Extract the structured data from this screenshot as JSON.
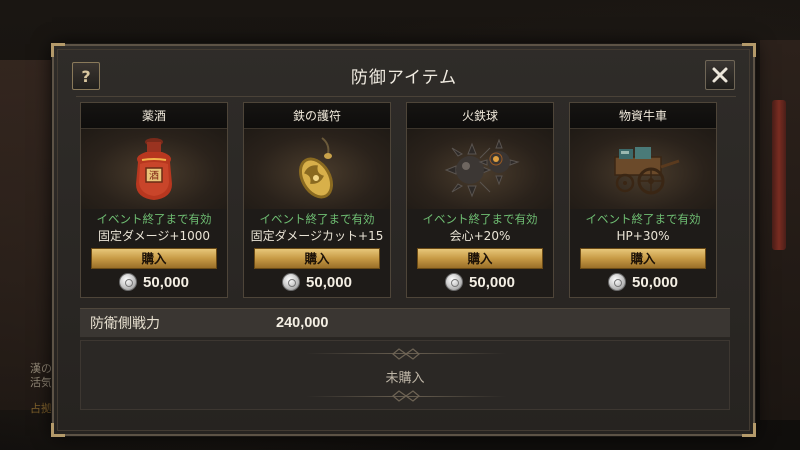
{
  "background": {
    "text_line1": "漢の",
    "text_line2": "活気",
    "text_line3": "占拠"
  },
  "dialog": {
    "title": "防御アイテム",
    "help_label": "?",
    "close_icon": "close-icon"
  },
  "items": [
    {
      "name": "薬酒",
      "icon": "wine-jar-icon",
      "status": "イベント終了まで有効",
      "effect": "固定ダメージ+1000",
      "buy_label": "購入",
      "price": "50,000"
    },
    {
      "name": "鉄の護符",
      "icon": "amulet-icon",
      "status": "イベント終了まで有効",
      "effect": "固定ダメージカット+15",
      "buy_label": "購入",
      "price": "50,000"
    },
    {
      "name": "火鉄球",
      "icon": "spiked-ball-icon",
      "status": "イベント終了まで有効",
      "effect": "会心+20%",
      "buy_label": "購入",
      "price": "50,000"
    },
    {
      "name": "物資牛車",
      "icon": "supply-cart-icon",
      "status": "イベント終了まで有効",
      "effect": "HP+30%",
      "buy_label": "購入",
      "price": "50,000"
    }
  ],
  "defense": {
    "label": "防衛側戦力",
    "value": "240,000"
  },
  "purchase_status": "未購入",
  "colors": {
    "status_green": "#6fbf73",
    "button_gold": "#c79a45",
    "panel_bg": "#2f2c29"
  }
}
